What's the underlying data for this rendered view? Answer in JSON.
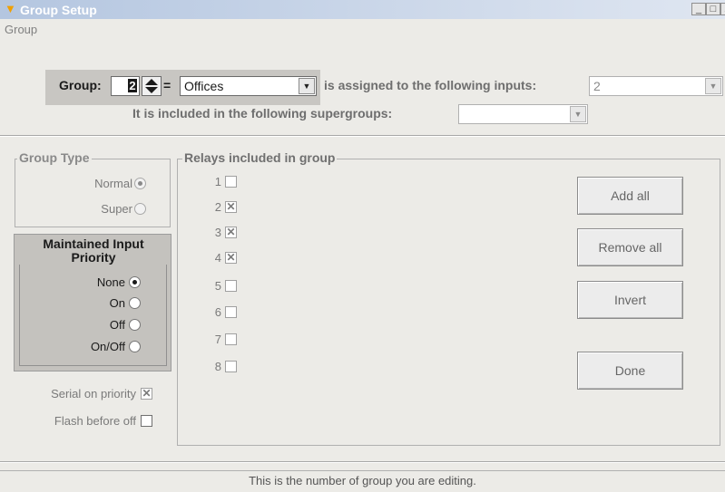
{
  "window": {
    "title": "Group Setup",
    "min_label": "_",
    "max_label": "□",
    "close_label": "X"
  },
  "menu": {
    "items": [
      "Group"
    ]
  },
  "group_selector": {
    "label": "Group:",
    "number": "2",
    "equals": "=",
    "name": "Offices",
    "inputs_label": "is assigned to the following inputs:",
    "inputs_value": "2",
    "supergroups_label": "It is included in the following supergroups:",
    "supergroups_value": ""
  },
  "group_type": {
    "title": "Group Type",
    "options": [
      {
        "label": "Normal",
        "selected": true
      },
      {
        "label": "Super",
        "selected": false
      }
    ]
  },
  "maintained_input": {
    "title_line1": "Maintained Input",
    "title_line2": "Priority",
    "options": [
      {
        "label": "None",
        "selected": true
      },
      {
        "label": "On",
        "selected": false
      },
      {
        "label": "Off",
        "selected": false
      },
      {
        "label": "On/Off",
        "selected": false
      }
    ]
  },
  "options": {
    "serial_label": "Serial on priority",
    "serial_checked": true,
    "flash_label": "Flash before off",
    "flash_checked": false
  },
  "relays": {
    "title": "Relays included in group",
    "items": [
      {
        "num": "1",
        "checked": false
      },
      {
        "num": "2",
        "checked": true
      },
      {
        "num": "3",
        "checked": true
      },
      {
        "num": "4",
        "checked": true
      },
      {
        "num": "5",
        "checked": false
      },
      {
        "num": "6",
        "checked": false
      },
      {
        "num": "7",
        "checked": false
      },
      {
        "num": "8",
        "checked": false
      }
    ]
  },
  "buttons": {
    "add_all": "Add all",
    "remove_all": "Remove all",
    "invert": "Invert",
    "done": "Done"
  },
  "status_bar": {
    "text": "This is the number of group you are editing."
  },
  "colors": {
    "title_bar": "#b4c6e0",
    "panel": "#c8c6c2",
    "background": "#ecebe7"
  }
}
